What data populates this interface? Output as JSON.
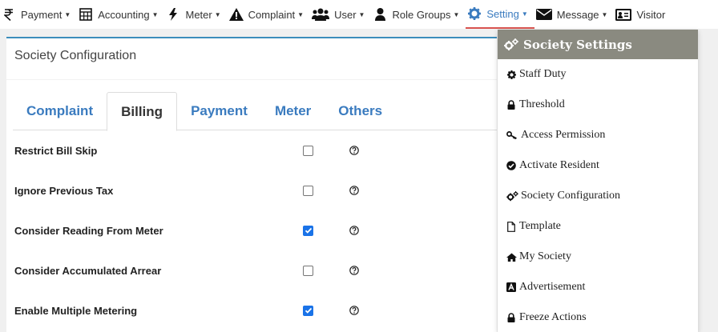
{
  "navbar": {
    "items": [
      {
        "label": "Payment",
        "icon": "rupee-icon"
      },
      {
        "label": "Accounting",
        "icon": "calculator-icon"
      },
      {
        "label": "Meter",
        "icon": "bolt-icon"
      },
      {
        "label": "Complaint",
        "icon": "warning-icon"
      },
      {
        "label": "User",
        "icon": "users-icon"
      },
      {
        "label": "Role Groups",
        "icon": "user-icon"
      },
      {
        "label": "Setting",
        "icon": "gear-icon"
      },
      {
        "label": "Message",
        "icon": "envelope-icon"
      },
      {
        "label": "Visitor",
        "icon": "id-card-icon"
      }
    ],
    "active_index": 6,
    "active_color": "#3a7bbf",
    "active_underline_color": "#d9534f"
  },
  "panel": {
    "title": "Society Configuration",
    "tabs": [
      "Complaint",
      "Billing",
      "Payment",
      "Meter",
      "Others"
    ],
    "active_tab": "Billing",
    "rows": [
      {
        "label": "Restrict Bill Skip",
        "checked": false
      },
      {
        "label": "Ignore Previous Tax",
        "checked": false
      },
      {
        "label": "Consider Reading From Meter",
        "checked": true
      },
      {
        "label": "Consider Accumulated Arrear",
        "checked": false
      },
      {
        "label": "Enable Multiple Metering",
        "checked": true
      }
    ]
  },
  "dropdown": {
    "header": "Society Settings",
    "header_color": "#8a8a80",
    "items": [
      {
        "label": "Staff Duty",
        "icon": "gear-icon"
      },
      {
        "label": "Threshold",
        "icon": "lock-icon"
      },
      {
        "label": "Access Permission",
        "icon": "key-icon"
      },
      {
        "label": "Activate Resident",
        "icon": "check-circle-icon"
      },
      {
        "label": "Society Configuration",
        "icon": "gears-icon"
      },
      {
        "label": "Template",
        "icon": "file-icon"
      },
      {
        "label": "My Society",
        "icon": "home-icon"
      },
      {
        "label": "Advertisement",
        "icon": "ad-icon"
      },
      {
        "label": "Freeze Actions",
        "icon": "lock-icon"
      }
    ]
  }
}
